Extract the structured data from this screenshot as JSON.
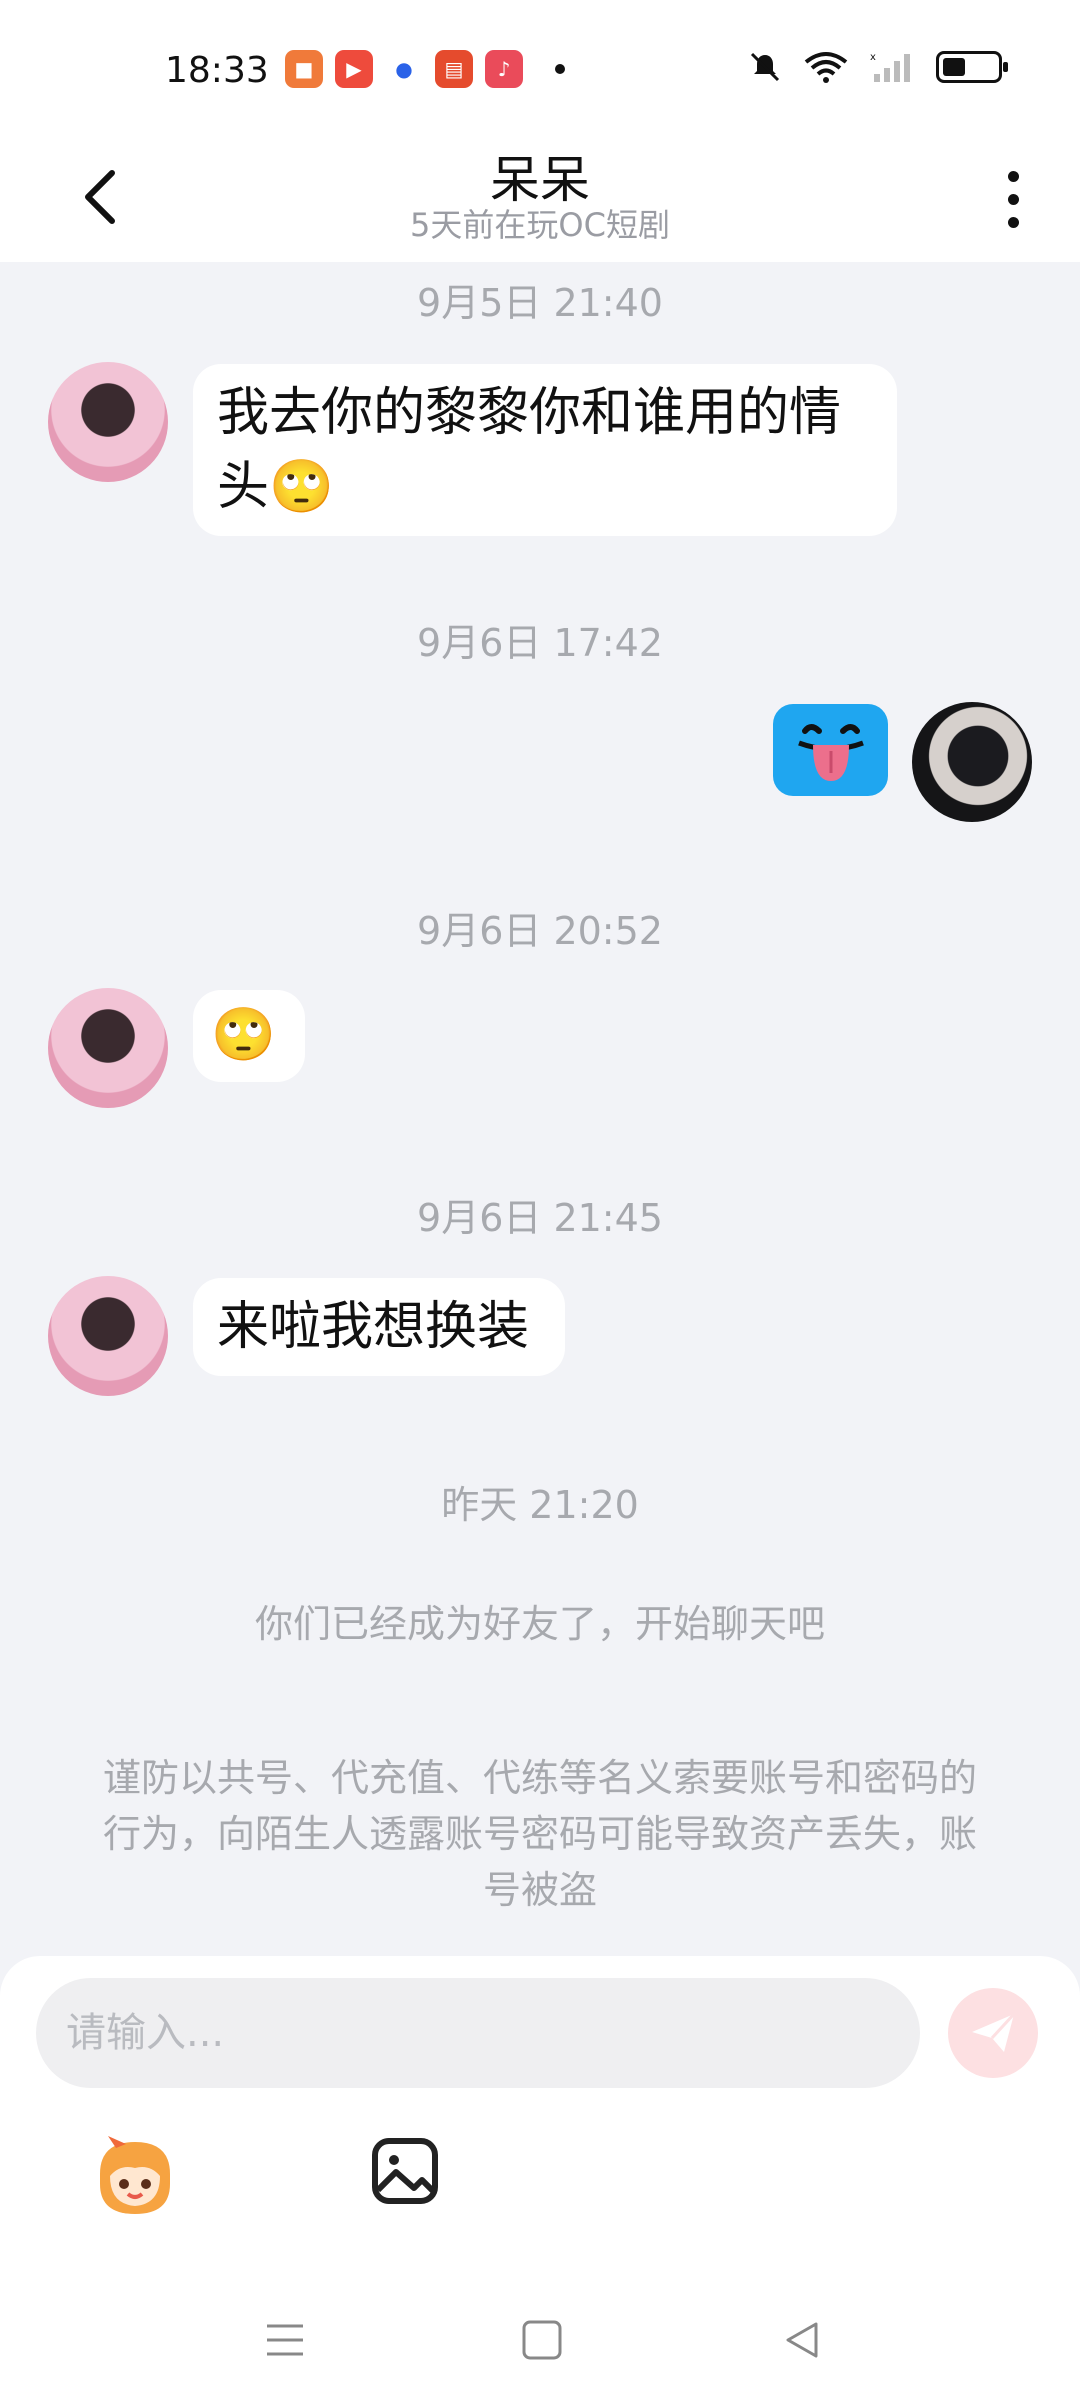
{
  "status_bar": {
    "time": "18:33",
    "app_icons": [
      {
        "name": "book-app-icon",
        "color": "#f07a3a",
        "glyph": "📖"
      },
      {
        "name": "video-app-icon",
        "color": "#ee4b3c",
        "glyph": "▶"
      },
      {
        "name": "baidu-app-icon",
        "color": "#ffffff",
        "glyph": "🐾"
      },
      {
        "name": "listen-app-icon",
        "color": "#e54b2d",
        "glyph": "听"
      },
      {
        "name": "music-app-icon",
        "color": "#ea4b5a",
        "glyph": "♪"
      }
    ]
  },
  "header": {
    "title": "呆呆",
    "subtitle": "5天前在玩OC短剧"
  },
  "messages": [
    {
      "timestamp": "9月5日 21:40"
    },
    {
      "text": "我去你的黎黎你和谁用的情头🙄"
    },
    {
      "timestamp": "9月6日 17:42"
    },
    {
      "sticker": "tongue-face"
    },
    {
      "timestamp": "9月6日 20:52"
    },
    {
      "text": "🙄"
    },
    {
      "timestamp": "9月6日 21:45"
    },
    {
      "text": "来啦我想换装"
    },
    {
      "timestamp": "昨天 21:20"
    }
  ],
  "system": {
    "friend_notice": "你们已经成为好友了，开始聊天吧",
    "security_notice": "谨防以共号、代充值、代练等名义索要账号和密码的行为，向陌生人透露账号密码可能导致资产丢失，账号被盗"
  },
  "input": {
    "placeholder": "请输入..."
  },
  "colors": {
    "background": "#f2f3f7",
    "send_button": "#fde0e2",
    "sticker_bg": "#1fa6f0"
  }
}
